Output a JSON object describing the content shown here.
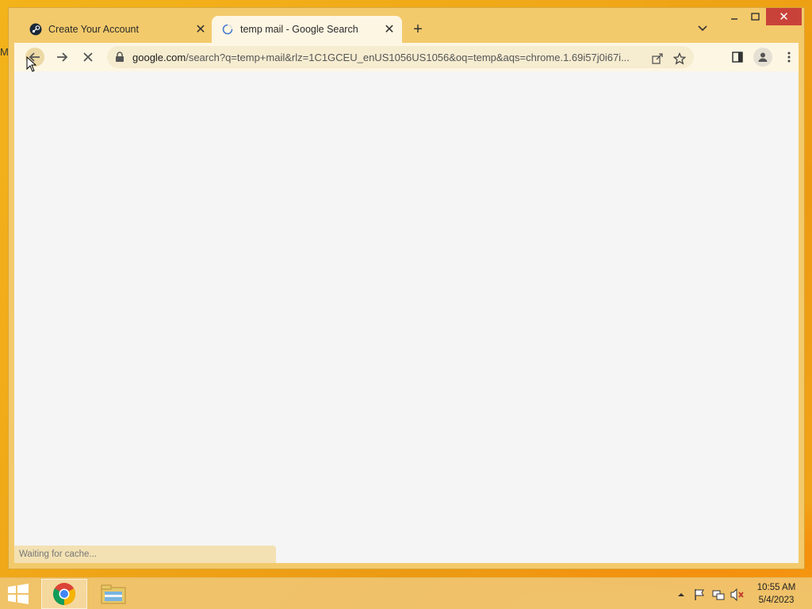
{
  "desktop": {
    "edge_mark": "M"
  },
  "browser": {
    "tabs": [
      {
        "title": "Create Your Account",
        "favicon": "steam-icon",
        "active": false
      },
      {
        "title": "temp mail - Google Search",
        "favicon": "google-loading-icon",
        "active": true
      }
    ],
    "new_tab_icon": "plus-icon",
    "tab_search_icon": "chevron-down-icon",
    "window_controls": [
      "minimize-icon",
      "maximize-icon",
      "close-icon"
    ],
    "toolbar": {
      "back_icon": "arrow-left-icon",
      "forward_icon": "arrow-right-icon",
      "stop_icon": "stop-loading-icon"
    },
    "address_bar": {
      "host": "google.com",
      "path": "/search?q=temp+mail&rlz=1C1GCEU_enUS1056US1056&oq=temp&aqs=chrome.1.69i57j0i67i..."
    },
    "status_text": "Waiting for cache...",
    "colors": {
      "frame": "#f3ca6b",
      "toolbar": "#fdf6e3",
      "content": "#f5f5f5"
    }
  },
  "taskbar": {
    "apps": [
      "chrome-icon",
      "file-explorer-icon"
    ],
    "clock": {
      "time": "10:55 AM",
      "date": "5/4/2023"
    }
  }
}
